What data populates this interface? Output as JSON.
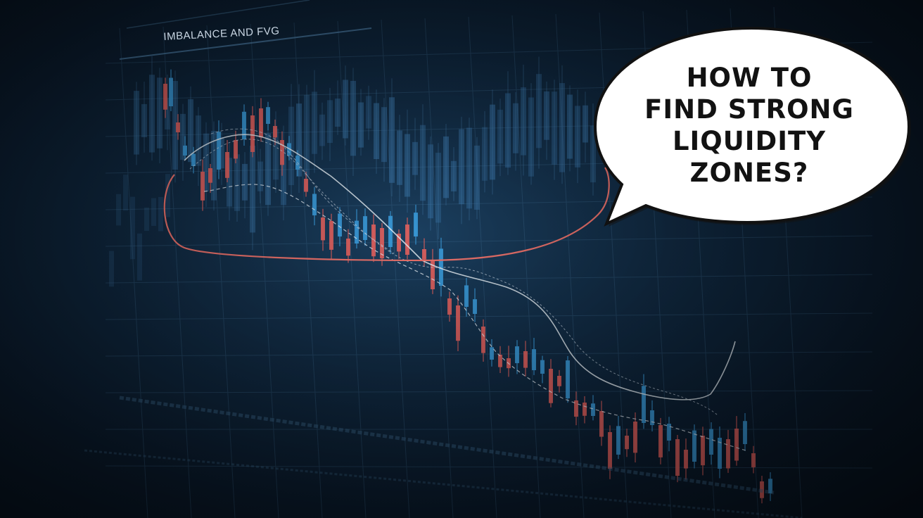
{
  "chart_title": "IMBALANCE AND FVG",
  "callout": {
    "lines": [
      "HOW TO",
      "FIND STRONG",
      "LIQUIDITY",
      "ZONES?"
    ]
  },
  "colors": {
    "background": "#0a1a2c",
    "bullish_candle": "#3a9ad9",
    "bearish_candle": "#e0605e",
    "liquidity_zone_outline": "#e8706a",
    "callout_fill": "#ffffff"
  }
}
